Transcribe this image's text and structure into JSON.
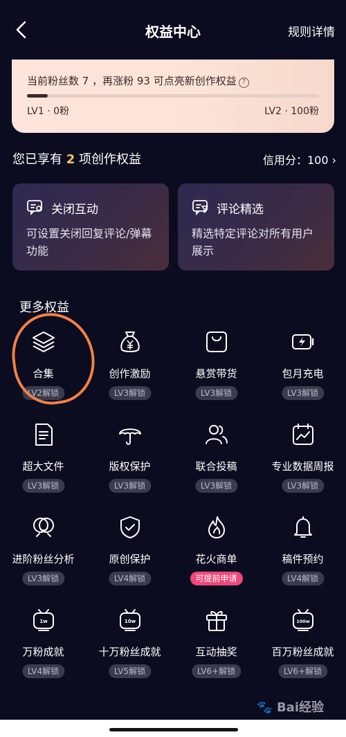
{
  "nav": {
    "title": "权益中心",
    "rules": "规则详情"
  },
  "level": {
    "fans_text": "当前粉丝数 7 ，再涨粉 93 可点亮新创作权益",
    "progress": 0.07,
    "lv_start": "LV1 · 0粉",
    "lv_end": "LV2 · 100粉"
  },
  "benefits": {
    "prefix": "您已享有 ",
    "count": "2",
    "suffix": " 项创作权益",
    "credit": "信用分：100 ›"
  },
  "cards": [
    {
      "title": "关闭互动",
      "desc": "可设置关闭回复评论/弹幕功能"
    },
    {
      "title": "评论精选",
      "desc": "精选特定评论对所有用户展示"
    }
  ],
  "more_title": "更多权益",
  "grid": [
    {
      "label": "合集",
      "badge": "LV2解锁",
      "icon": "layers-icon"
    },
    {
      "label": "创作激励",
      "badge": "LV3解锁",
      "icon": "money-bag-icon"
    },
    {
      "label": "悬赏带货",
      "badge": "LV3解锁",
      "icon": "shopping-bag-icon"
    },
    {
      "label": "包月充电",
      "badge": "LV3解锁",
      "icon": "battery-charge-icon"
    },
    {
      "label": "超大文件",
      "badge": "LV3解锁",
      "icon": "document-icon"
    },
    {
      "label": "版权保护",
      "badge": "LV3解锁",
      "icon": "umbrella-icon"
    },
    {
      "label": "联合投稿",
      "badge": "LV3解锁",
      "icon": "users-icon"
    },
    {
      "label": "专业数据周报",
      "badge": "LV3解锁",
      "icon": "calendar-chart-icon"
    },
    {
      "label": "进阶粉丝分析",
      "badge": "LV3解锁",
      "icon": "fans-analysis-icon"
    },
    {
      "label": "原创保护",
      "badge": "LV4解锁",
      "icon": "shield-check-icon"
    },
    {
      "label": "花火商单",
      "badge": "可提前申请",
      "icon": "flame-icon",
      "badge_color": "#f1477a"
    },
    {
      "label": "稿件预约",
      "badge": "LV4解锁",
      "icon": "bell-icon"
    },
    {
      "label": "万粉成就",
      "badge": "LV4解锁",
      "icon": "tv-1w-icon",
      "icon_text": "1w"
    },
    {
      "label": "十万粉丝成就",
      "badge": "LV5解锁",
      "icon": "tv-10w-icon",
      "icon_text": "10w"
    },
    {
      "label": "互动抽奖",
      "badge": "LV6+解锁",
      "icon": "gift-icon"
    },
    {
      "label": "百万粉丝成就",
      "badge": "LV6+解锁",
      "icon": "tv-100w-icon",
      "icon_text": "100w"
    }
  ],
  "watermark": "Bai经验"
}
